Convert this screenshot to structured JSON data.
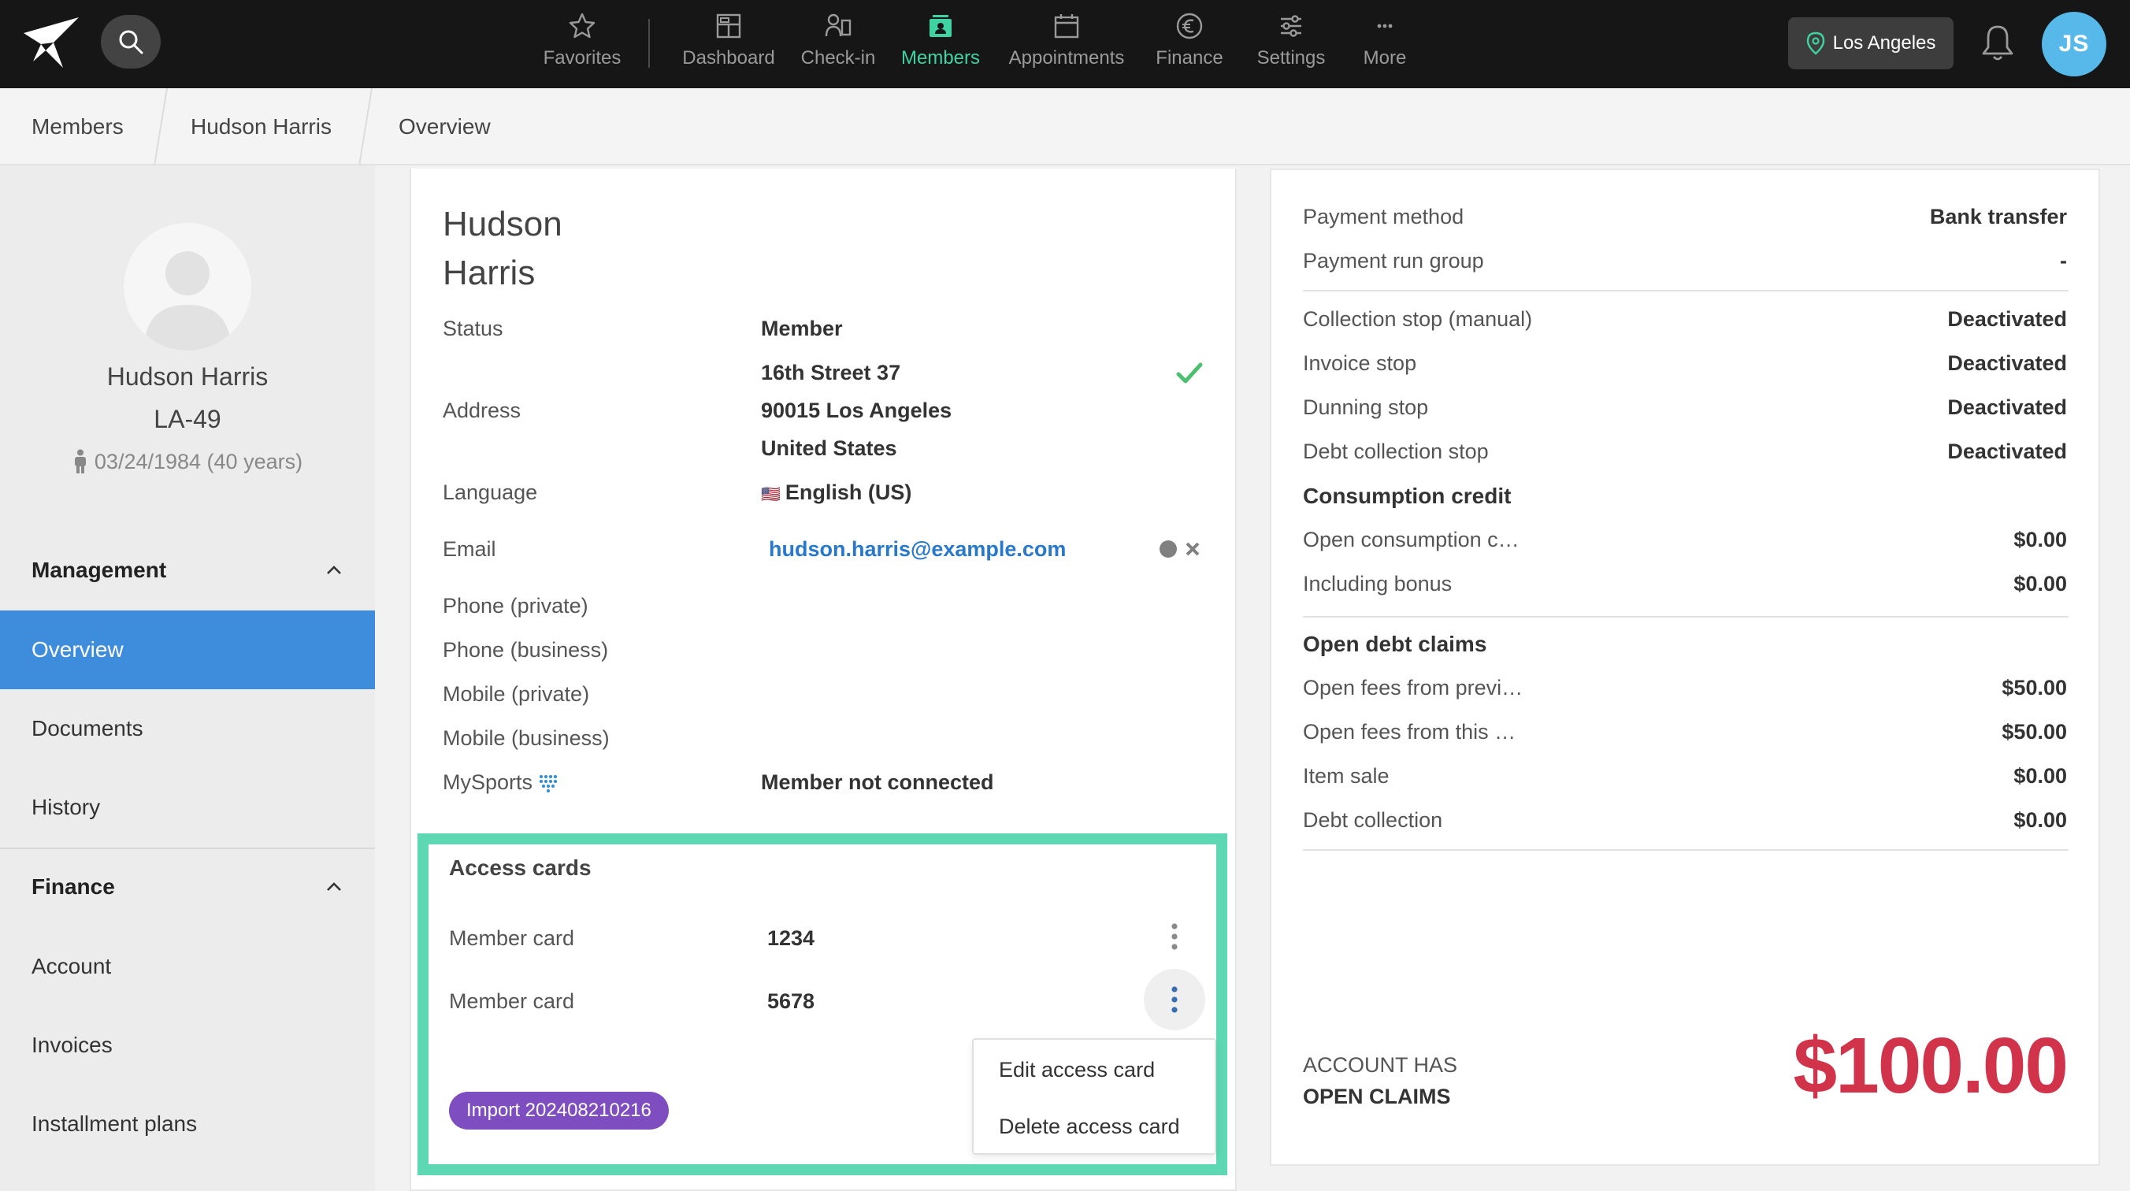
{
  "nav": {
    "items": [
      {
        "label": "Favorites",
        "icon": "star-icon"
      },
      {
        "label": "Dashboard",
        "icon": "dashboard-icon"
      },
      {
        "label": "Check-in",
        "icon": "check-in-icon"
      },
      {
        "label": "Members",
        "icon": "members-icon",
        "active": true
      },
      {
        "label": "Appointments",
        "icon": "calendar-icon"
      },
      {
        "label": "Finance",
        "icon": "euro-icon"
      },
      {
        "label": "Settings",
        "icon": "sliders-icon"
      },
      {
        "label": "More",
        "icon": "more-icon"
      }
    ],
    "location": "Los Angeles",
    "user_initials": "JS",
    "accent_color": "#3fd2a3"
  },
  "breadcrumb": [
    "Members",
    "Hudson Harris",
    "Overview"
  ],
  "sidebar": {
    "profile": {
      "name": "Hudson Harris",
      "id": "LA-49",
      "dob": "03/24/1984 (40 years)"
    },
    "sections": [
      {
        "title": "Management",
        "items": [
          "Overview",
          "Documents",
          "History"
        ]
      },
      {
        "title": "Finance",
        "items": [
          "Account",
          "Invoices",
          "Installment plans"
        ]
      }
    ],
    "active_item": "Overview"
  },
  "member": {
    "first_name": "Hudson",
    "last_name": "Harris",
    "status_label": "Status",
    "status_value": "Member",
    "address_label": "Address",
    "address_lines": [
      "16th Street 37",
      "90015 Los Angeles",
      "United States"
    ],
    "language_label": "Language",
    "language_flag": "🇺🇸",
    "language_value": "English (US)",
    "email_label": "Email",
    "email_value": "hudson.harris@example.com",
    "phone_private_label": "Phone (private)",
    "phone_business_label": "Phone (business)",
    "mobile_private_label": "Mobile (private)",
    "mobile_business_label": "Mobile (business)",
    "mysports_label": "MySports",
    "mysports_value": "Member not connected"
  },
  "access_cards": {
    "title": "Access cards",
    "cards": [
      {
        "label": "Member card",
        "number": "1234"
      },
      {
        "label": "Member card",
        "number": "5678"
      }
    ],
    "import_badge": "Import 202408210216",
    "menu": [
      "Edit access card",
      "Delete access card"
    ],
    "highlight_color": "#5dd8b3"
  },
  "finance": {
    "payment_method_label": "Payment method",
    "payment_method_value": "Bank transfer",
    "payment_run_group_label": "Payment run group",
    "payment_run_group_value": "-",
    "collection_stop_label": "Collection stop (manual)",
    "collection_stop_value": "Deactivated",
    "invoice_stop_label": "Invoice stop",
    "invoice_stop_value": "Deactivated",
    "dunning_stop_label": "Dunning stop",
    "dunning_stop_value": "Deactivated",
    "debt_collection_stop_label": "Debt collection stop",
    "debt_collection_stop_value": "Deactivated",
    "consumption_credit_title": "Consumption credit",
    "open_consumption_label": "Open consumption c…",
    "open_consumption_value": "$0.00",
    "including_bonus_label": "Including bonus",
    "including_bonus_value": "$0.00",
    "open_debt_title": "Open debt claims",
    "open_fees_prev_label": "Open fees from previ…",
    "open_fees_prev_value": "$50.00",
    "open_fees_this_label": "Open fees from this …",
    "open_fees_this_value": "$50.00",
    "item_sale_label": "Item sale",
    "item_sale_value": "$0.00",
    "debt_collection_label": "Debt collection",
    "debt_collection_value": "$0.00",
    "claims_line1": "ACCOUNT HAS",
    "claims_line2": "OPEN CLAIMS",
    "claims_amount": "$100.00",
    "claims_color": "#d0334a"
  }
}
